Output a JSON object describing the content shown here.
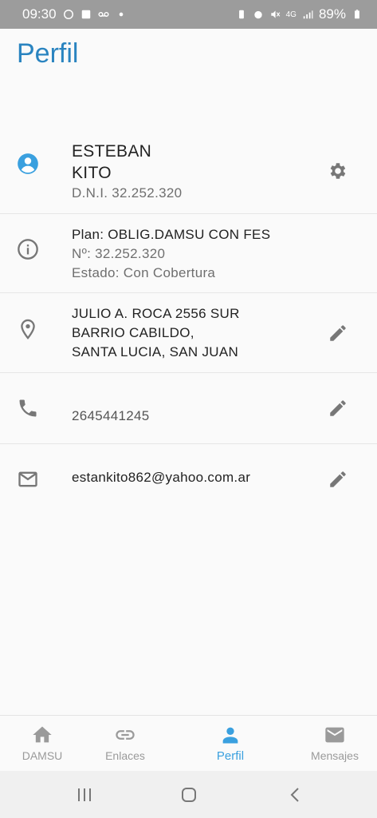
{
  "status_bar": {
    "time": "09:30",
    "battery": "89%",
    "network": "4G"
  },
  "page": {
    "title": "Perfil"
  },
  "profile": {
    "first_name": "ESTEBAN",
    "last_name": "KITO",
    "dni": "D.N.I. 32.252.320"
  },
  "plan": {
    "name": "Plan: OBLIG.DAMSU CON FES",
    "number": "Nº: 32.252.320",
    "status": "Estado: Con Cobertura"
  },
  "address": {
    "line1": "JULIO A. ROCA 2556 SUR",
    "line2": "BARRIO CABILDO,",
    "line3": "SANTA LUCIA, SAN JUAN"
  },
  "phone": {
    "value": "2645441245"
  },
  "email": {
    "value": "estankito862@yahoo.com.ar"
  },
  "bottom_nav": {
    "items": [
      {
        "label": "DAMSU",
        "icon": "home-icon"
      },
      {
        "label": "Enlaces",
        "icon": "link-icon"
      },
      {
        "label": "Perfil",
        "icon": "person-icon",
        "active": true
      },
      {
        "label": "Mensajes",
        "icon": "mail-icon"
      }
    ]
  },
  "colors": {
    "accent": "#2a84c0",
    "active_nav": "#3aa0df",
    "status_bar": "#9c9c9c",
    "icon_gray": "#777777"
  }
}
